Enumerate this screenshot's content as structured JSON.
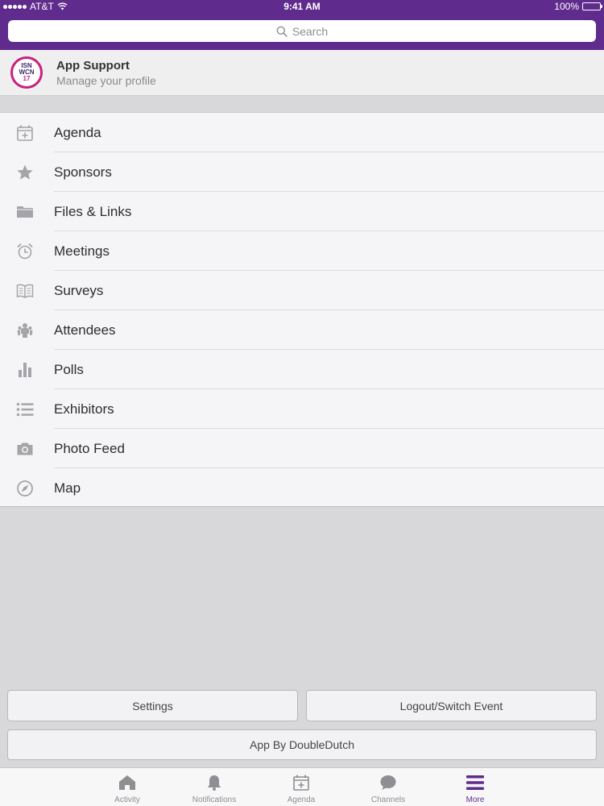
{
  "status_bar": {
    "carrier": "AT&T",
    "time": "9:41 AM",
    "battery": "100%"
  },
  "search": {
    "placeholder": "Search"
  },
  "profile": {
    "name": "App Support",
    "subtitle": "Manage your profile",
    "logo_text": [
      "ISN",
      "WCN",
      "17"
    ]
  },
  "menu": {
    "items": [
      {
        "label": "Agenda",
        "icon": "calendar-plus-icon"
      },
      {
        "label": "Sponsors",
        "icon": "star-icon"
      },
      {
        "label": "Files & Links",
        "icon": "folder-icon"
      },
      {
        "label": "Meetings",
        "icon": "alarm-clock-icon"
      },
      {
        "label": "Surveys",
        "icon": "open-book-icon"
      },
      {
        "label": "Attendees",
        "icon": "people-icon"
      },
      {
        "label": "Polls",
        "icon": "bar-chart-icon"
      },
      {
        "label": "Exhibitors",
        "icon": "list-icon"
      },
      {
        "label": "Photo Feed",
        "icon": "camera-icon"
      },
      {
        "label": "Map",
        "icon": "compass-icon"
      }
    ]
  },
  "buttons": {
    "settings": "Settings",
    "logout": "Logout/Switch Event",
    "app_by": "App By DoubleDutch"
  },
  "tabbar": {
    "tabs": [
      {
        "label": "Activity",
        "icon": "home-icon"
      },
      {
        "label": "Notifications",
        "icon": "bell-icon"
      },
      {
        "label": "Agenda",
        "icon": "calendar-plus-icon"
      },
      {
        "label": "Channels",
        "icon": "chat-bubble-icon"
      },
      {
        "label": "More",
        "icon": "menu-icon",
        "active": true
      }
    ]
  },
  "colors": {
    "brand": "#5f2b8c",
    "accent": "#c8207e",
    "icon_gray": "#a5a5a9",
    "background": "#d8d8da"
  }
}
